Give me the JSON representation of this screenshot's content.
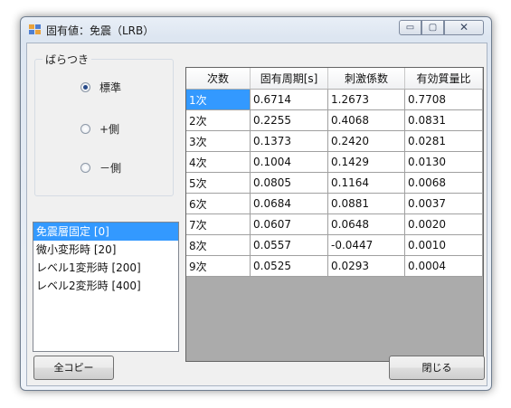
{
  "window": {
    "title": "固有値：免震（LRB）",
    "controls": {
      "minimize": "▭",
      "maximize": "▢",
      "close": "✕"
    }
  },
  "variation_group": {
    "label": "ばらつき",
    "options": [
      {
        "label": "標準",
        "selected": true
      },
      {
        "label": "+側",
        "selected": false
      },
      {
        "label": "－側",
        "selected": false
      }
    ]
  },
  "state_list": {
    "items": [
      "免震層固定 [0]",
      "微小変形時 [20]",
      "レベル1変形時 [200]",
      "レベル2変形時 [400]"
    ],
    "selected_index": 0
  },
  "grid": {
    "columns": [
      "次数",
      "固有周期[s]",
      "刺激係数",
      "有効質量比"
    ],
    "rows": [
      [
        "1次",
        "0.6714",
        "1.2673",
        "0.7708"
      ],
      [
        "2次",
        "0.2255",
        "0.4068",
        "0.0831"
      ],
      [
        "3次",
        "0.1373",
        "0.2420",
        "0.0281"
      ],
      [
        "4次",
        "0.1004",
        "0.1429",
        "0.0130"
      ],
      [
        "5次",
        "0.0805",
        "0.1164",
        "0.0068"
      ],
      [
        "6次",
        "0.0684",
        "0.0881",
        "0.0037"
      ],
      [
        "7次",
        "0.0607",
        "0.0648",
        "0.0020"
      ],
      [
        "8次",
        "0.0557",
        "-0.0447",
        "0.0010"
      ],
      [
        "9次",
        "0.0525",
        "0.0293",
        "0.0004"
      ]
    ],
    "selected_row": 0
  },
  "buttons": {
    "copy_all": "全コピー",
    "close": "閉じる"
  }
}
